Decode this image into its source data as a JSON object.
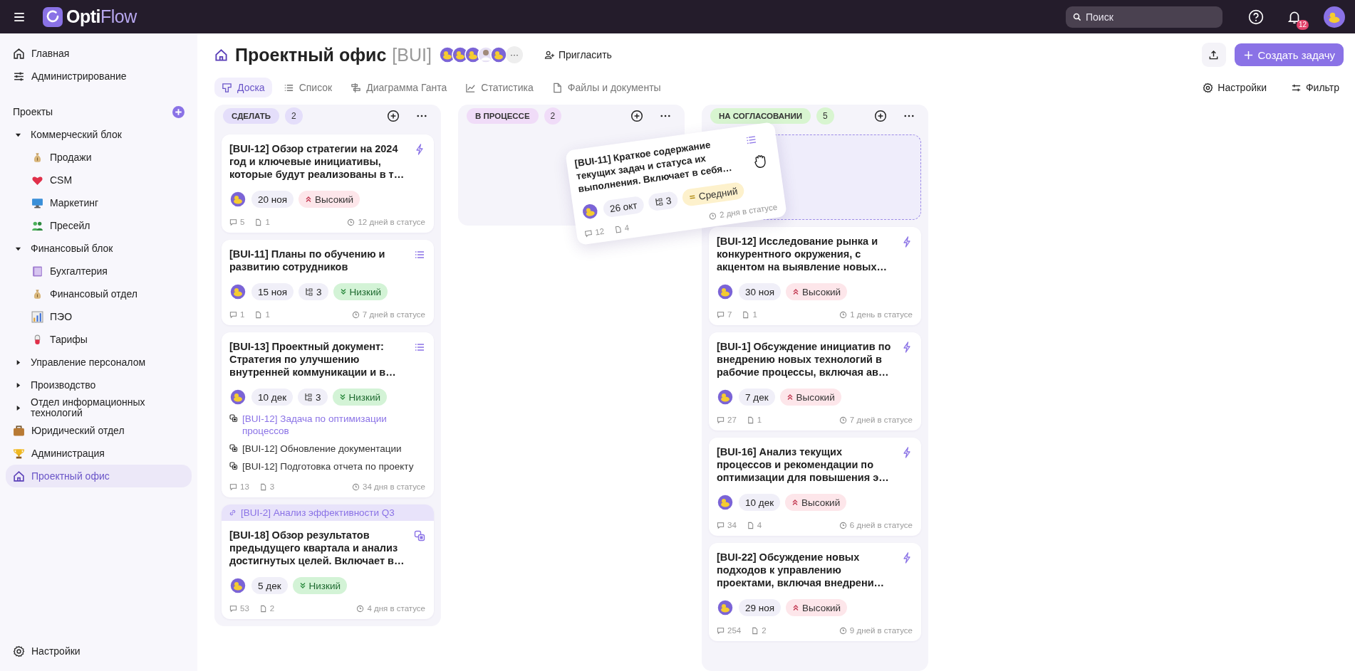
{
  "topbar": {
    "brand_prefix": "Opti",
    "brand_suffix": "Flow",
    "search": {
      "placeholder": "Поиск"
    },
    "notifications": "12"
  },
  "sidebar": {
    "top_items": [
      {
        "label": "Главная",
        "kind": "home",
        "selected": false
      },
      {
        "label": "Администрирование",
        "kind": "sliders",
        "selected": false
      }
    ],
    "projects_label": "Проекты",
    "tree": [
      {
        "label": "Коммерческий блок",
        "expanded": true,
        "selected": false,
        "children": [
          {
            "label": "Продажи",
            "kind": "moneybag",
            "selected": false
          },
          {
            "label": "CSM",
            "kind": "heart",
            "selected": false
          },
          {
            "label": "Маркетинг",
            "kind": "monitor",
            "selected": false
          },
          {
            "label": "Пресейл",
            "kind": "people",
            "selected": false
          }
        ]
      },
      {
        "label": "Финансовый блок",
        "expanded": true,
        "selected": false,
        "children": [
          {
            "label": "Бухгалтерия",
            "kind": "book",
            "selected": false
          },
          {
            "label": "Финансовый отдел",
            "kind": "moneybag",
            "selected": false
          },
          {
            "label": "ПЭО",
            "kind": "chart",
            "selected": false
          },
          {
            "label": "Тарифы",
            "kind": "pill",
            "selected": false
          }
        ]
      },
      {
        "label": "Управление персоналом",
        "expanded": false,
        "selected": false
      },
      {
        "label": "Производство",
        "expanded": false,
        "selected": false
      },
      {
        "label": "Отдел информационных технологий",
        "expanded": false,
        "selected": false
      },
      {
        "label": "Юридический отдел",
        "kind": "briefcase",
        "selected": false
      },
      {
        "label": "Администрация",
        "kind": "trophy",
        "selected": false
      },
      {
        "label": "Проектный офис",
        "kind": "house",
        "selected": true
      }
    ],
    "settings": "Настройки"
  },
  "header": {
    "title": "Проектный офис",
    "code": "[BUI]",
    "members": [
      {
        "kind": "duck"
      },
      {
        "kind": "duck"
      },
      {
        "kind": "duck"
      },
      {
        "kind": "person"
      },
      {
        "kind": "duck"
      }
    ],
    "members_more": "···",
    "invite": "Пригласить",
    "create": "Создать задачу",
    "tabs": [
      {
        "label": "Доска",
        "kind": "board",
        "selected": true
      },
      {
        "label": "Список",
        "kind": "list",
        "selected": false
      },
      {
        "label": "Диаграмма Ганта",
        "kind": "gantt",
        "selected": false
      },
      {
        "label": "Статистика",
        "kind": "stats",
        "selected": false
      },
      {
        "label": "Файлы и документы",
        "kind": "file",
        "selected": false
      }
    ],
    "settings": "Настройки",
    "filter": "Фильтр"
  },
  "columns": [
    {
      "label": "СДЕЛАТЬ",
      "count": "2",
      "color": "#e4defa",
      "drop_placeholder": false,
      "cards": [
        {
          "title": "[BUI-12] Обзор стратегии на 2024 год и ключевые инициативы, которые будут реализованы в т…",
          "kind": "bolt",
          "date": "20 ноя",
          "priority": {
            "label": "Высокий",
            "kind": "high"
          },
          "comments": "5",
          "attachments": "1",
          "status_time": "12 дней в статусе"
        },
        {
          "title": "[BUI-11] Планы по обучению и развитию сотрудников",
          "kind": "list",
          "date": "15 ноя",
          "subtasks": "3",
          "priority": {
            "label": "Низкий",
            "kind": "low"
          },
          "comments": "1",
          "attachments": "1",
          "status_time": "7 дней в статусе"
        },
        {
          "title": "[BUI-13] Проектный документ: Стратегия по улучшению внутренней коммуникации и в…",
          "kind": "list",
          "date": "10 дек",
          "subtasks": "3",
          "priority": {
            "label": "Низкий",
            "kind": "low"
          },
          "subitems": [
            {
              "text": "[BUI-12] Задача по оптимизации процессов",
              "link": true
            },
            {
              "text": "[BUI-12] Обновление документации",
              "link": false
            },
            {
              "text": "[BUI-12] Подготовка отчета по проекту",
              "link": false
            }
          ],
          "comments": "13",
          "attachments": "3",
          "status_time": "34 дня в статусе"
        },
        {
          "parent": "[BUI-2] Анализ эффективности Q3",
          "title": "[BUI-18] Обзор результатов предыдущего квартала и анализ достигнутых целей. Включает в…",
          "kind": "subtask",
          "date": "5 дек",
          "priority": {
            "label": "Низкий",
            "kind": "low"
          },
          "comments": "53",
          "attachments": "2",
          "status_time": "4 дня в статусе"
        }
      ]
    },
    {
      "label": "В ПРОЦЕССЕ",
      "count": "2",
      "color": "#f0dcf8",
      "drop_placeholder": false
    },
    {
      "label": "НА СОГЛАСОВАНИИ",
      "count": "5",
      "color": "#d8f5d0",
      "drop_placeholder": true,
      "cards": [
        {
          "title": "[BUI-12] Исследование рынка и конкурентного окружения, с акцентом на выявление новых…",
          "kind": "bolt",
          "date": "30 ноя",
          "priority": {
            "label": "Высокий",
            "kind": "high"
          },
          "comments": "7",
          "attachments": "1",
          "status_time": "1 день в статусе"
        },
        {
          "title": "[BUI-1] Обсуждение инициатив по внедрению новых технологий в рабочие процессы, включая ав…",
          "kind": "bolt",
          "date": "7 дек",
          "priority": {
            "label": "Высокий",
            "kind": "high"
          },
          "comments": "27",
          "attachments": "1",
          "status_time": "7 дней в статусе"
        },
        {
          "title": "[BUI-16] Анализ текущих процессов и рекомендации по оптимизации для повышения э…",
          "kind": "bolt",
          "date": "10 дек",
          "priority": {
            "label": "Высокий",
            "kind": "high"
          },
          "comments": "34",
          "attachments": "4",
          "status_time": "6 дней в статусе"
        },
        {
          "title": "[BUI-22] Обсуждение новых подходов к управлению проектами, включая внедрени…",
          "kind": "bolt",
          "date": "29 ноя",
          "priority": {
            "label": "Высокий",
            "kind": "high"
          },
          "comments": "254",
          "attachments": "2",
          "status_time": "9 дней в статусе"
        }
      ]
    }
  ],
  "dragged_card": {
    "title": "[BUI-11] Краткое содержание текущих задач и статуса их выполнения. Включает в себя…",
    "kind": "list",
    "date": "26 окт",
    "subtasks": "3",
    "priority": {
      "label": "Средний",
      "kind": "medium"
    },
    "comments": "12",
    "attachments": "4",
    "status_time": "2 дня в статусе"
  }
}
